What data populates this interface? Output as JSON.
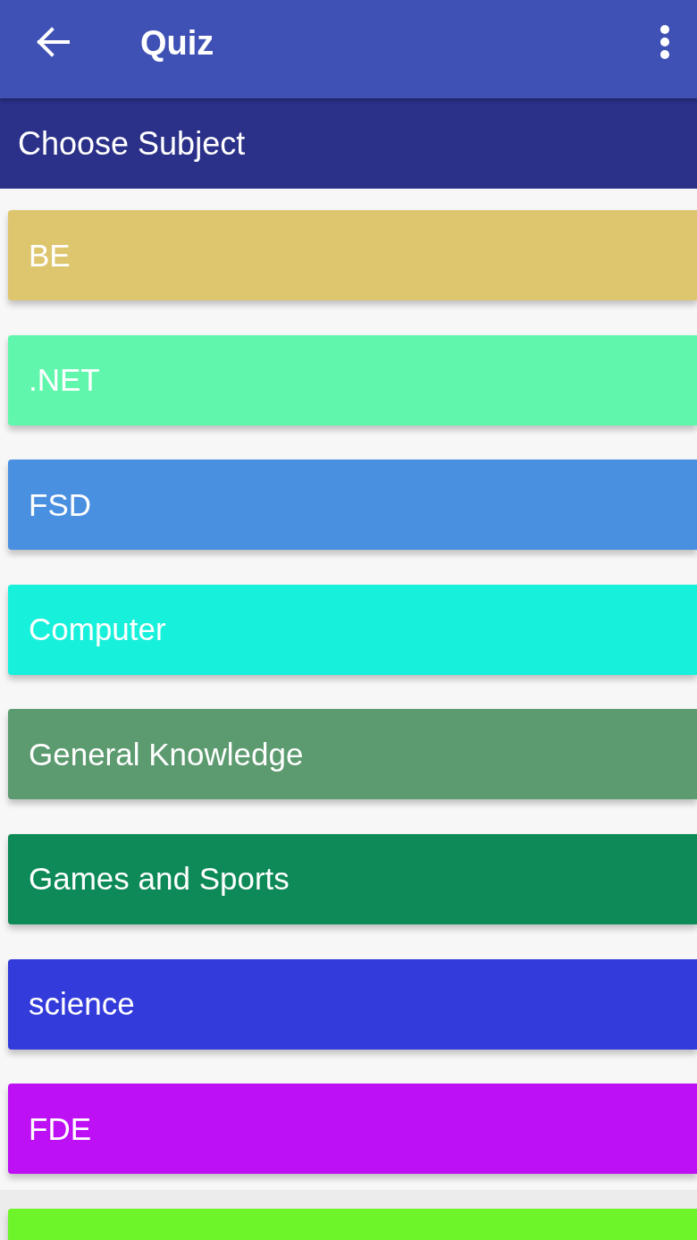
{
  "app_bar": {
    "title": "Quiz"
  },
  "section_header": {
    "title": "Choose Subject"
  },
  "subjects": [
    {
      "label": "BE",
      "color": "#dec66e"
    },
    {
      "label": ".NET",
      "color": "#60f7ac"
    },
    {
      "label": "FSD",
      "color": "#4a90e0"
    },
    {
      "label": "Computer",
      "color": "#17f0da"
    },
    {
      "label": "General Knowledge",
      "color": "#5c9a6f"
    },
    {
      "label": "Games and Sports",
      "color": "#0d8a57"
    },
    {
      "label": "science",
      "color": "#343bdb"
    },
    {
      "label": "FDE",
      "color": "#bd10f5"
    },
    {
      "color": "#6ef52a"
    }
  ]
}
